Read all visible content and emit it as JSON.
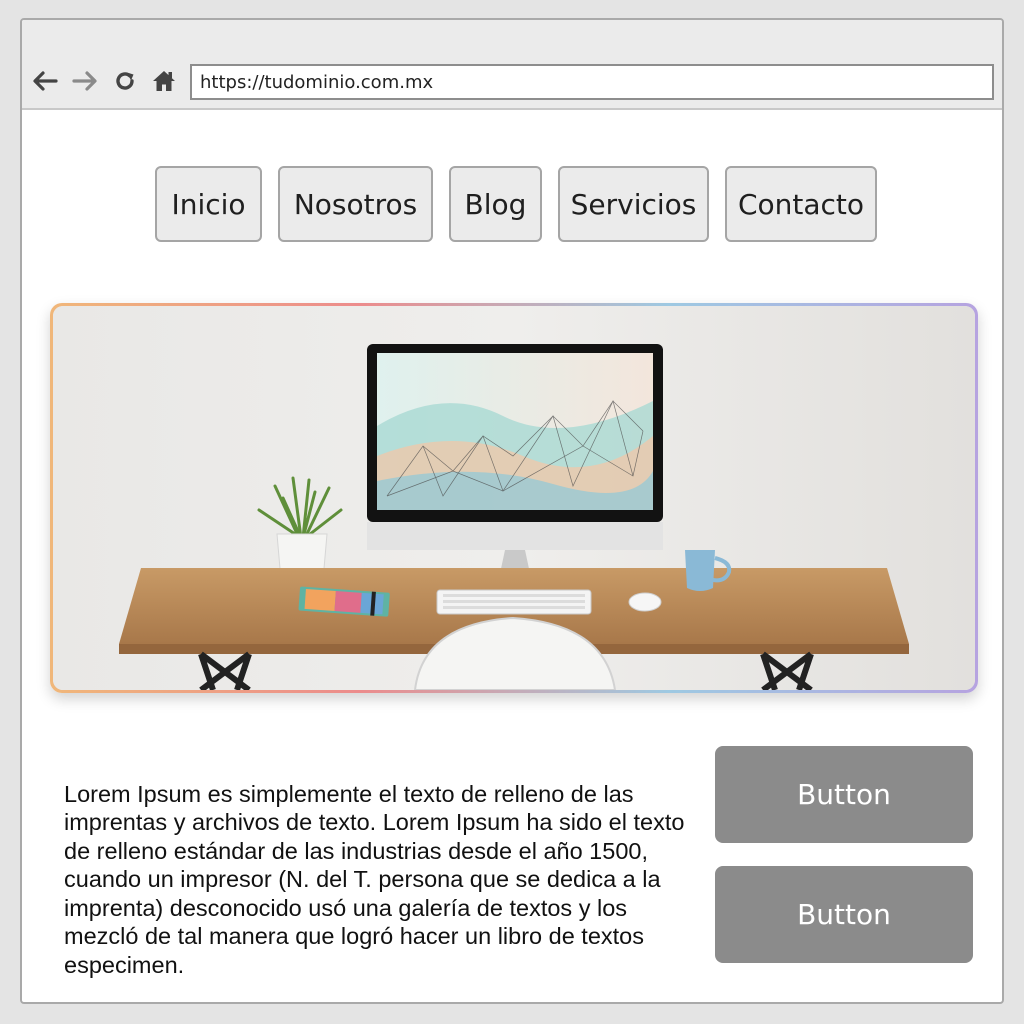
{
  "browser": {
    "back_icon": "arrow-left-icon",
    "forward_icon": "arrow-right-icon",
    "reload_icon": "reload-icon",
    "home_icon": "home-icon",
    "url": "https://tudominio.com.mx"
  },
  "nav": {
    "items": [
      {
        "label": "Inicio"
      },
      {
        "label": "Nosotros"
      },
      {
        "label": "Blog"
      },
      {
        "label": "Servicios"
      },
      {
        "label": "Contacto"
      }
    ]
  },
  "hero": {
    "image": "desk-workspace-photo"
  },
  "content": {
    "paragraph": "Lorem Ipsum es simplemente el texto de relleno de las imprentas y archivos de texto. Lorem Ipsum ha sido el texto de relleno estándar de las industrias desde el año 1500, cuando un impresor (N. del T. persona que se dedica a la imprenta) desconocido usó una galería de textos y los mezcló de tal manera que logró hacer un libro de textos especimen.",
    "buttons": [
      {
        "label": "Button"
      },
      {
        "label": "Button"
      }
    ]
  },
  "colors": {
    "button_gray": "#8b8b8b",
    "menu_bg": "#ebebeb"
  }
}
